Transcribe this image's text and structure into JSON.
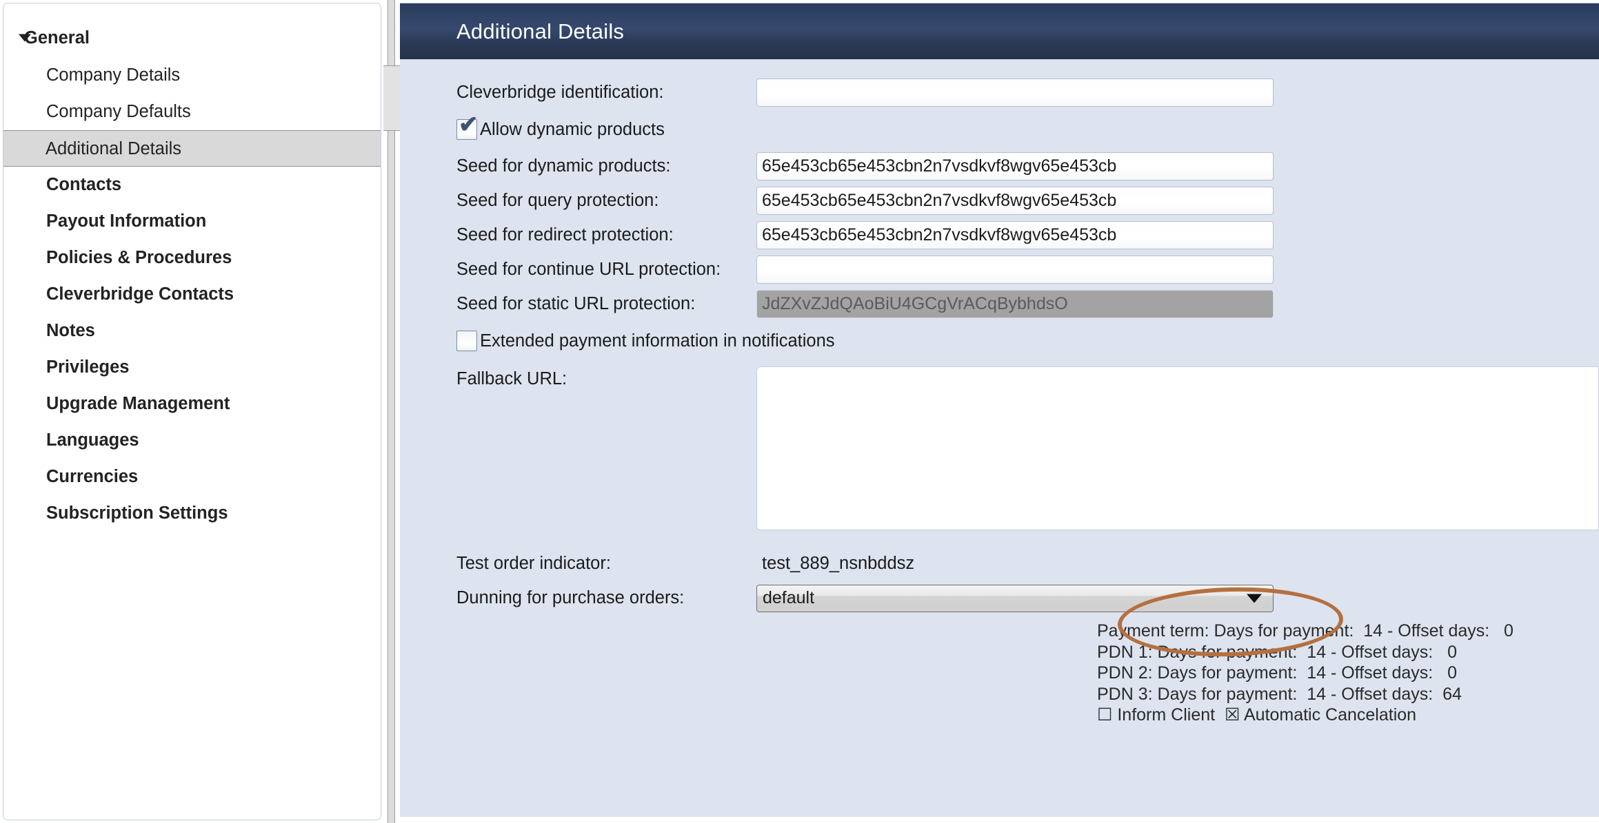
{
  "sidebar": {
    "items": [
      {
        "label": "General",
        "type": "group",
        "expanded": true,
        "selected": false
      },
      {
        "label": "Company Details",
        "type": "child",
        "selected": false
      },
      {
        "label": "Company Defaults",
        "type": "child",
        "selected": false
      },
      {
        "label": "Additional Details",
        "type": "child",
        "selected": true
      },
      {
        "label": "Contacts",
        "type": "bold-child",
        "selected": false
      },
      {
        "label": "Payout Information",
        "type": "bold-child",
        "selected": false
      },
      {
        "label": "Policies & Procedures",
        "type": "bold-child",
        "selected": false
      },
      {
        "label": "Cleverbridge Contacts",
        "type": "bold-child",
        "selected": false
      },
      {
        "label": "Notes",
        "type": "bold-child",
        "selected": false
      },
      {
        "label": "Privileges",
        "type": "bold-child",
        "selected": false
      },
      {
        "label": "Upgrade Management",
        "type": "bold-child",
        "selected": false
      },
      {
        "label": "Languages",
        "type": "bold-child",
        "selected": false
      },
      {
        "label": "Currencies",
        "type": "bold-child",
        "selected": false
      },
      {
        "label": "Subscription Settings",
        "type": "bold-child",
        "selected": false
      }
    ]
  },
  "main": {
    "header_title": "Additional Details",
    "fields": {
      "cleverbridge_identification": {
        "label": "Cleverbridge identification:",
        "value": "",
        "placeholder": ""
      },
      "allow_dynamic_products": {
        "label": "Allow dynamic products",
        "checked": true,
        "check_glyph": "✔"
      },
      "seed_dynamic_products": {
        "label": "Seed for dynamic products:",
        "value": "65e453cb65e453cbn2n7vsdkvf8wgv65e453cb"
      },
      "seed_query_protection": {
        "label": "Seed for query protection:",
        "value": "65e453cb65e453cbn2n7vsdkvf8wgv65e453cb"
      },
      "seed_redirect_protection": {
        "label": "Seed for redirect protection:",
        "value": "65e453cb65e453cbn2n7vsdkvf8wgv65e453cb"
      },
      "seed_continue_url_protection": {
        "label": "Seed for continue URL protection:",
        "value": ""
      },
      "seed_static_url_protection": {
        "label": "Seed for static URL protection:",
        "value": "JdZXvZJdQAoBiU4GCgVrACqBybhdsO",
        "disabled": true
      },
      "extended_payment_information": {
        "label": "Extended payment information in notifications",
        "checked": false,
        "check_glyph": ""
      },
      "fallback_url": {
        "label": "Fallback URL:",
        "value": "",
        "focused": true
      },
      "test_order_indicator": {
        "label": "Test order indicator:",
        "value": "test_889_nsnbddsz"
      },
      "dunning_for_purchase_orders": {
        "label": "Dunning for purchase orders:",
        "value": "default",
        "options": [
          "default"
        ]
      }
    },
    "payment_terms": {
      "lines": [
        "Payment term: Days for payment:  14 - Offset days:   0",
        "PDN 1: Days for payment:  14 - Offset days:   0",
        "PDN 2: Days for payment:  14 - Offset days:   0",
        "PDN 3: Days for payment:  14 - Offset days:  64"
      ],
      "checkbox_line": "☐ Inform Client  ☒ Automatic Cancelation",
      "inform_client_label": "Inform Client",
      "inform_client_glyph": "☐",
      "automatic_cancelation_label": "Automatic Cancelation",
      "automatic_cancelation_glyph": "☒"
    }
  },
  "annotation": {
    "shape": "ellipse",
    "target": "test_889_nsnbddsz",
    "color": "#b5703f"
  },
  "colors": {
    "header_navy": "#2b3c5e",
    "panel_bg": "#dde3ef",
    "selected_nav": "#d9d9d9",
    "disabled_field": "#a3a3a3",
    "annotation": "#b5703f"
  }
}
